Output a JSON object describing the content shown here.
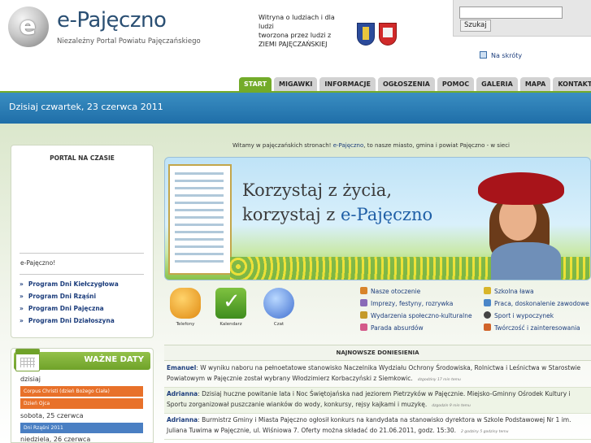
{
  "header": {
    "title": "e-Pajęczno",
    "subtitle": "Niezależny Portal Powiatu Pajęczańskiego",
    "tagline": [
      "Witryna o ludziach i dla ludzi",
      "tworzona przez ludzi z",
      "ZIEMI PAJĘCZAŃSKIEJ"
    ]
  },
  "search": {
    "placeholder": "",
    "button_label": "Szukaj"
  },
  "shortcut_label": "Na skróty",
  "nav": {
    "tabs": [
      "START",
      "MIGAWKI",
      "INFORMACJE",
      "OGŁOSZENIA",
      "POMOC",
      "GALERIA",
      "MAPA",
      "KONTAKT"
    ],
    "active": "START"
  },
  "date_banner": "Dzisiaj czwartek, 23 czerwca 2011",
  "left": {
    "panel_title": "PORTAL NA CZASIE",
    "text": "e-Pajęczno!",
    "links": [
      "Program Dni Kiełczygłowa",
      "Program Dni Rząśni",
      "Program Dni Pajęczna",
      "Program Dni Działoszyna"
    ]
  },
  "dates": {
    "title": "WAŻNE DATY",
    "days": [
      {
        "label": "dzisiaj",
        "event": "Corpus Christi (dzień Bożego Ciała)",
        "event2": "Dzień Ojca",
        "color": "#e8712a"
      },
      {
        "label": "sobota, 25 czerwca",
        "event": "Dni Rząśni 2011",
        "color": "#4a7fc3"
      },
      {
        "label": "niedziela, 26 czerwca"
      }
    ]
  },
  "welcome": {
    "before": "Witamy w pajęczańskich stronach! ",
    "brand": "e-Pajęczno",
    "after": ", to nasze miasto, gmina i powiat Pajęczno - w sieci"
  },
  "banner": {
    "line1": "Korzystaj z życia,",
    "line2_prefix": "korzystaj z ",
    "line2_brand": "e-Pajęczno"
  },
  "tiles": [
    {
      "label": "Telefony",
      "icon": "phone-icon"
    },
    {
      "label": "Kalendarz",
      "icon": "calendar-check-icon"
    },
    {
      "label": "Czat",
      "icon": "chat-icon"
    }
  ],
  "categories_left": [
    {
      "label": "Nasze otoczenie",
      "icon": "house-icon",
      "color": "#d8842a"
    },
    {
      "label": "Imprezy, festyny, rozrywka",
      "icon": "music-icon",
      "color": "#8a6bb8"
    },
    {
      "label": "Wydarzenia społeczno-kulturalne",
      "icon": "theatre-icon",
      "color": "#c49a2a"
    },
    {
      "label": "Parada absurdów",
      "icon": "pencil-icon",
      "color": "#d45a8a"
    }
  ],
  "categories_right": [
    {
      "label": "Szkolna ława",
      "icon": "school-icon",
      "color": "#d8b52a"
    },
    {
      "label": "Praca, doskonalenie zawodowe",
      "icon": "tools-icon",
      "color": "#4a86c8"
    },
    {
      "label": "Sport i wypoczynek",
      "icon": "ball-icon",
      "color": "#444444"
    },
    {
      "label": "Twórczość i zainteresowania",
      "icon": "palette-icon",
      "color": "#d0642a"
    }
  ],
  "news": {
    "title": "NAJNOWSZE DONIESIENIA",
    "items": [
      {
        "author": "Emanuel",
        "text": ": W wyniku naboru na pełnoetatowe stanowisko Naczelnika Wydziału Ochrony Środowiska, Rolnictwa i Leśnictwa w Starostwie Powiatowym w Pajęcznie został wybrany Włodzimierz Korbaczyński z Siemkowic.",
        "ago": "dzgodziny 17 min temu"
      },
      {
        "author": "Adrianna",
        "text": ": Dzisiaj huczne powitanie lata i Noc Świętojańska nad jeziorem Pietrzyków w Pajęcznie. Miejsko-Gminny Ośrodek Kultury i Sportu zorganizował puszczanie wianków do wody, konkursy, rejsy kajkami i muzykę.",
        "ago": "dzgodzin 9 min temu"
      },
      {
        "author": "Adrianna",
        "text": ": Burmistrz Gminy i Miasta Pajęczno ogłosił konkurs na kandydata na stanowisko dyrektora w Szkole Podstawowej Nr 1 im. Juliana Tuwima w Pajęcznie, ul. Wiśniowa 7. Oferty można składać do 21.06.2011, godz. 15:30.",
        "ago": "2 godziny 5 godziny temu"
      }
    ]
  }
}
